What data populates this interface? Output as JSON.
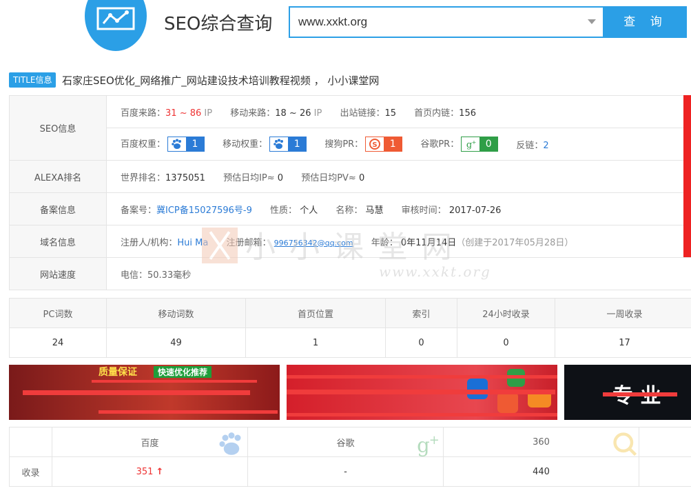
{
  "header": {
    "title": "SEO综合查询",
    "search_value": "www.xxkt.org",
    "search_button": "查 询",
    "logo_icon": "chart-monitor-icon"
  },
  "title_info": {
    "tag": "TITLE信息",
    "text": "石家庄SEO优化_网络推广_网站建设技术培训教程视频 ， 小小课堂网"
  },
  "seo": {
    "label": "SEO信息",
    "baidu_traffic_label": "百度来路：",
    "baidu_traffic_low": "31",
    "baidu_traffic_sep": " ~ ",
    "baidu_traffic_high": "86",
    "ip_unit": " IP",
    "mobile_traffic_label": "移动来路：",
    "mobile_traffic_value": "18 ~ 26",
    "outbound_label": "出站链接：",
    "outbound_value": "15",
    "internal_label": "首页内链：",
    "internal_value": "156",
    "baidu_weight_label": "百度权重：",
    "baidu_weight": "1",
    "mobile_weight_label": "移动权重：",
    "mobile_weight": "1",
    "sogou_pr_label": "搜狗PR：",
    "sogou_pr": "1",
    "google_pr_label": "谷歌PR：",
    "google_pr": "0",
    "backlink_label": "反链：",
    "backlink_value": "2"
  },
  "alexa": {
    "label": "ALEXA排名",
    "world_rank_label": "世界排名：",
    "world_rank": "1375051",
    "daily_ip_label": "预估日均IP≈",
    "daily_ip": "0",
    "daily_pv_label": "预估日均PV≈",
    "daily_pv": "0"
  },
  "icp": {
    "label": "备案信息",
    "number_label": "备案号：",
    "number": "冀ICP备15027596号-9",
    "nature_label": "性质：",
    "nature": "个人",
    "name_label": "名称：",
    "name": "马慧",
    "audit_label": "审核时间：",
    "audit_date": "2017-07-26"
  },
  "domain": {
    "label": "域名信息",
    "registrant_label": "注册人/机构：",
    "registrant": "Hui Ma",
    "email_label": "注册邮箱：",
    "email": "996756342@qq.com",
    "age_label": "年龄：",
    "age": "0年11月14日",
    "created": "（创建于2017年05月28日）"
  },
  "speed": {
    "label": "网站速度",
    "value": "电信：50.33毫秒"
  },
  "watermark": {
    "cn": "小小课堂网",
    "en": "www.xxkt.org"
  },
  "stats": {
    "headers": [
      "PC词数",
      "移动词数",
      "首页位置",
      "索引",
      "24小时收录",
      "一周收录"
    ],
    "values": [
      "24",
      "49",
      "1",
      "0",
      "0",
      "17"
    ]
  },
  "banners": {
    "b1_top": "质量保证",
    "b1_badge": "快速优化推荐",
    "b3_text": "专 业"
  },
  "engines": {
    "headers": [
      "",
      "百度",
      "谷歌",
      "360",
      ""
    ],
    "row_label": "收录",
    "baidu": "351",
    "baidu_arrow": "↑",
    "google": "-",
    "so360": "440",
    "baidu_icon": "baidu-paw-icon",
    "google_icon": "google-plus-icon",
    "so360_icon": "360-search-icon"
  },
  "colors": {
    "accent": "#2b9fe6",
    "red": "#e33333",
    "link": "#2b7bd6",
    "sogou": "#ef5a33",
    "google": "#2f9e47"
  }
}
